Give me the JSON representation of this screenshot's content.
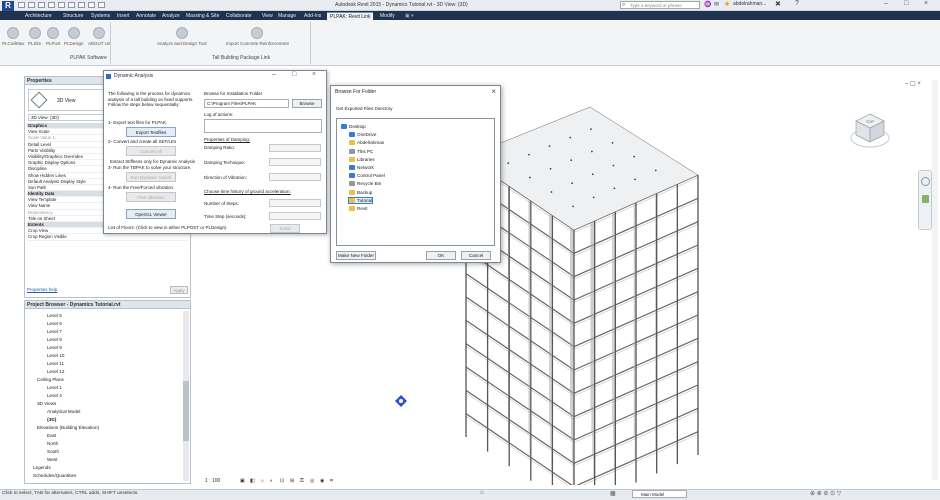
{
  "titlebar": {
    "app_title": "Autodesk Revit 2015 -   Dynamics Tutorial.rvt - 3D View: {3D}",
    "search_placeholder": "Type a keyword or phrase",
    "user": "abdelrahman..."
  },
  "tabs": [
    "Architecture",
    "Structure",
    "Systems",
    "Insert",
    "Annotate",
    "Analyze",
    "Massing & Site",
    "Collaborate",
    "View",
    "Manage",
    "Add-Ins",
    "PLPAK: Revit Link",
    "Modify"
  ],
  "active_tab": "PLPAK: Revit Link",
  "ribbon": {
    "buttons": [
      "PLCivilMax",
      "PLSlm",
      "PLPost",
      "PLDesign",
      "ABOUT US",
      "Analyze and Design Tool",
      "Import Concrete Reinforcement"
    ],
    "panel_plpak": "PLPAK Software",
    "panel_tall": "Tall Building Package Link"
  },
  "properties": {
    "title": "Properties",
    "type_name": "3D View",
    "view_selector": "3D View: {3D}",
    "rows": [
      {
        "label": "Graphics",
        "group": true
      },
      {
        "label": "View Scale",
        "group": false
      },
      {
        "label": "Scale Value    1:",
        "group": false,
        "gray": true
      },
      {
        "label": "Detail Level",
        "group": false
      },
      {
        "label": "Parts Visibility",
        "group": false
      },
      {
        "label": "Visibility/Graphics Overrides",
        "group": false
      },
      {
        "label": "Graphic Display Options",
        "group": false
      },
      {
        "label": "Discipline",
        "group": false
      },
      {
        "label": "Show Hidden Lines",
        "group": false
      },
      {
        "label": "Default Analysis Display Style",
        "group": false
      },
      {
        "label": "Sun Path",
        "group": false
      },
      {
        "label": "Identity Data",
        "group": true
      },
      {
        "label": "View Template",
        "group": false
      },
      {
        "label": "View Name",
        "group": false
      },
      {
        "label": "Dependency",
        "group": false,
        "gray": true
      },
      {
        "label": "Title on Sheet",
        "group": false
      },
      {
        "label": "Extents",
        "group": true
      },
      {
        "label": "Crop View",
        "group": false
      },
      {
        "label": "Crop Region Visible",
        "group": false
      }
    ],
    "help_link": "Properties help",
    "apply": "Apply"
  },
  "project_browser": {
    "title": "Project Browser - Dynamics Tutorial.rvt",
    "items": [
      "Level 5",
      "Level 6",
      "Level 7",
      "Level 8",
      "Level 9",
      "Level 10",
      "Level 11",
      "Level 12",
      "Ceiling Plans",
      "Level 1",
      "Level 4",
      "3D Views",
      "Analytical Model",
      "{3D}",
      "Elevations (Building Elevation)",
      "East",
      "North",
      "South",
      "West",
      "Legends",
      "Schedules/Quantities"
    ]
  },
  "status": {
    "text": "Click to select, TAB for alternates, CTRL adds, SHIFT unselects.",
    "model": "Main Model",
    "view_scale": "1 : 100"
  },
  "dynamic_dialog": {
    "title": "Dynamic Analysis",
    "intro": [
      "The following is the process for dynamics",
      "analysis of a tall building on fixed supports.",
      "Follow the steps below sequentially:"
    ],
    "step1": "1- Export text files for PLPAK.",
    "export_btn": "Export Textfiles",
    "step2": "2- Convert and create all SEF/LEs",
    "convert_btn": "Convert All",
    "extract": "Extract Stiffness only for Dynamic Analysis",
    "step3": "3- Run the TBPAK to solve your structure.",
    "run_btn": "Run Dynamic Solver",
    "step4": "4- Run the Free/Forced vibration.",
    "vib_btn": "Free vibration",
    "opengl_btn": "OpenGL Viewer",
    "floors": "List of Floors: (Click to view in either PLPOST or PLDesign)",
    "browse_label": "Browse for Installation Folder",
    "path": "C:\\Program Files\\PLPAK",
    "browse_btn": "Browse",
    "log": "Log of actions:",
    "damping_hdr": "Properties of Damping:",
    "damping_ratio": "Damping Ratio:",
    "damping_tech": "Damping Technique:",
    "direction": "Direction of Vibration:",
    "time_hdr": "Choose time history of ground acceleration:",
    "steps": "Number of Steps:",
    "time_step": "Time Step (seconds):",
    "solve_btn": "Solve"
  },
  "browse_dialog": {
    "title": "Browse For Folder",
    "subtitle": "Get Exported Files Directory",
    "tree": [
      {
        "label": "Desktop",
        "indent": 0,
        "icon": "blue"
      },
      {
        "label": "OneDrive",
        "indent": 1,
        "icon": "blue"
      },
      {
        "label": "Abdelrahman",
        "indent": 1,
        "icon": "yellow"
      },
      {
        "label": "This PC",
        "indent": 1,
        "icon": "gray"
      },
      {
        "label": "Libraries",
        "indent": 1,
        "icon": "yellow"
      },
      {
        "label": "Network",
        "indent": 1,
        "icon": "blue"
      },
      {
        "label": "Control Panel",
        "indent": 1,
        "icon": "blue"
      },
      {
        "label": "Recycle Bin",
        "indent": 1,
        "icon": "gray"
      },
      {
        "label": "Backup",
        "indent": 1,
        "icon": "yellow"
      },
      {
        "label": "Tutorial",
        "indent": 1,
        "icon": "yellow",
        "selected": true
      },
      {
        "label": "Revit",
        "indent": 1,
        "icon": "yellow"
      }
    ],
    "make_folder": "Make New Folder",
    "ok": "OK",
    "cancel": "Cancel"
  },
  "navcube_face": "TOP"
}
